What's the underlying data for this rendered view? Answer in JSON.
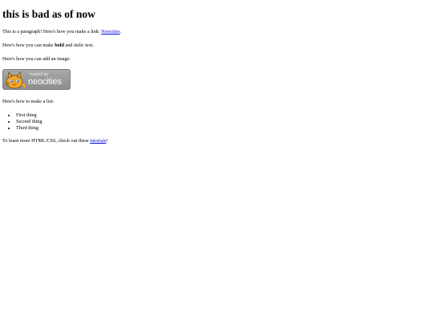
{
  "heading": "this is bad as of now",
  "para1": {
    "text": "This is a paragraph! Here's how you make a link: ",
    "link": "Neocities",
    "after": "."
  },
  "para2": {
    "before": "Here's how you can make ",
    "bold": "bold",
    "middle": " and ",
    "italic": "italic",
    "after": " text."
  },
  "para3": "Here's how you can add an image:",
  "badge": {
    "top": "hosted by",
    "brand": "neocities"
  },
  "para4": "Here's how to make a list:",
  "list": [
    "First thing",
    "Second thing",
    "Third thing"
  ],
  "para5": {
    "before": "To learn more HTML/CSS, check out these ",
    "link": "tutorials",
    "after": "!"
  },
  "colors": {
    "link": "#0000ee",
    "badge_bg": "#999999",
    "cat": "#f6a623"
  }
}
